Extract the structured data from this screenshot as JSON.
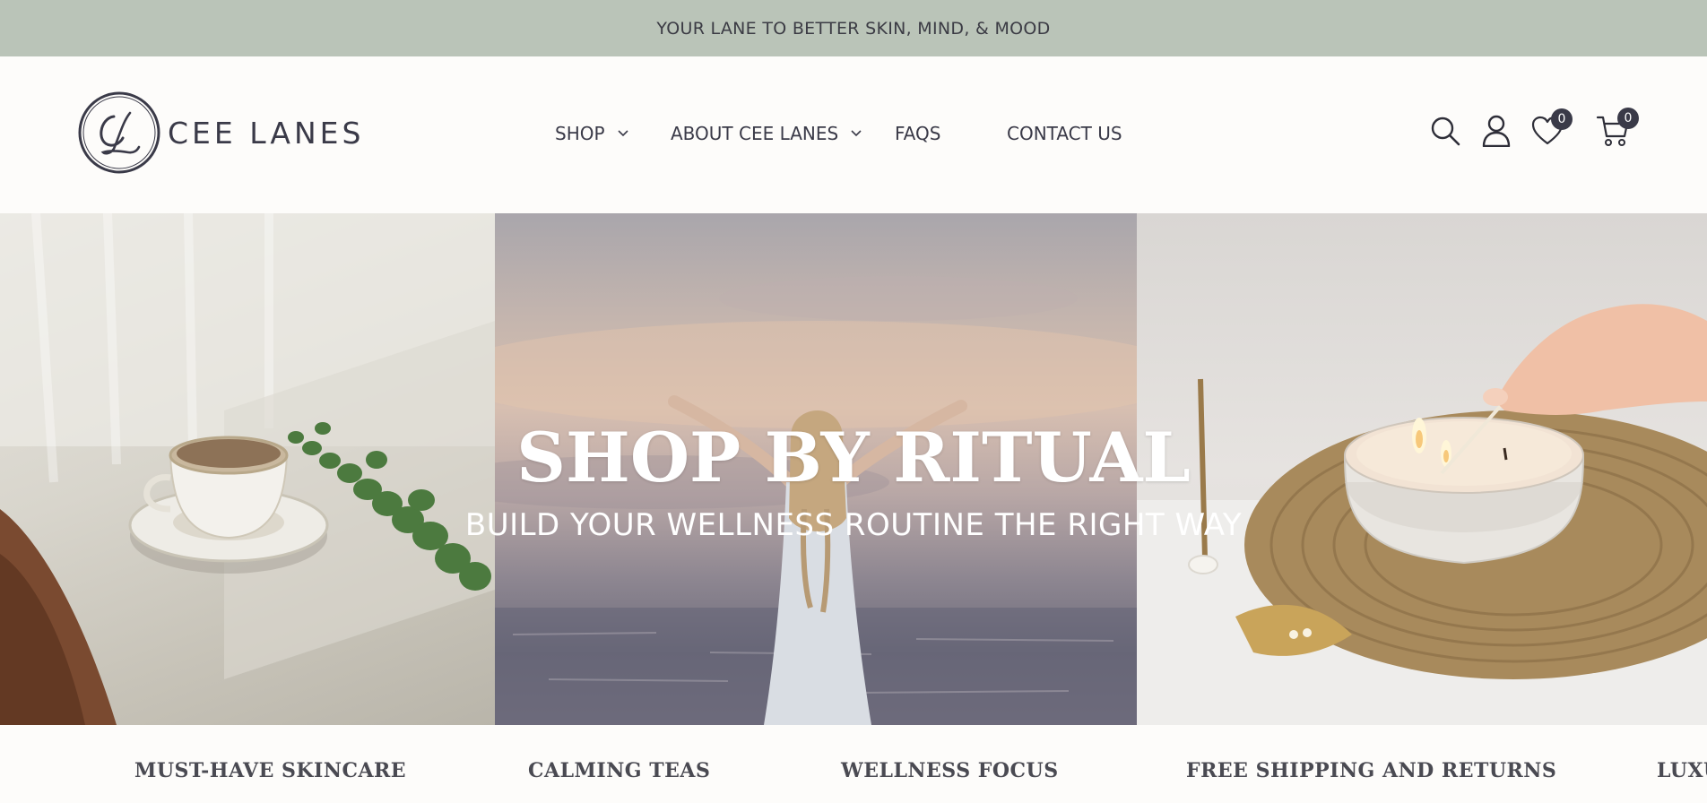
{
  "announcement": {
    "text": "YOUR LANE TO BETTER SKIN, MIND, & MOOD"
  },
  "brand": {
    "name": "CEE LANES",
    "monogram": "CL"
  },
  "nav": {
    "shop": "SHOP",
    "about": "ABOUT CEE LANES",
    "faqs": "FAQS",
    "contact": "CONTACT US"
  },
  "header_icons": {
    "search": "search-icon",
    "account": "user-icon",
    "wishlist": {
      "icon": "heart-icon",
      "count": "0"
    },
    "cart": {
      "icon": "cart-icon",
      "count": "0"
    }
  },
  "hero": {
    "title": "SHOP BY RITUAL",
    "subtitle": "BUILD YOUR WELLNESS ROUTINE THE RIGHT WAY"
  },
  "ticker": {
    "items": [
      "MUST-HAVE SKINCARE",
      "CALMING TEAS",
      "WELLNESS FOCUS",
      "FREE SHIPPING AND RETURNS",
      "LUXU"
    ]
  },
  "colors": {
    "announcement_bg": "#bac4b8",
    "text_dark": "#3a3a48",
    "page_bg": "#fdfcfa"
  }
}
